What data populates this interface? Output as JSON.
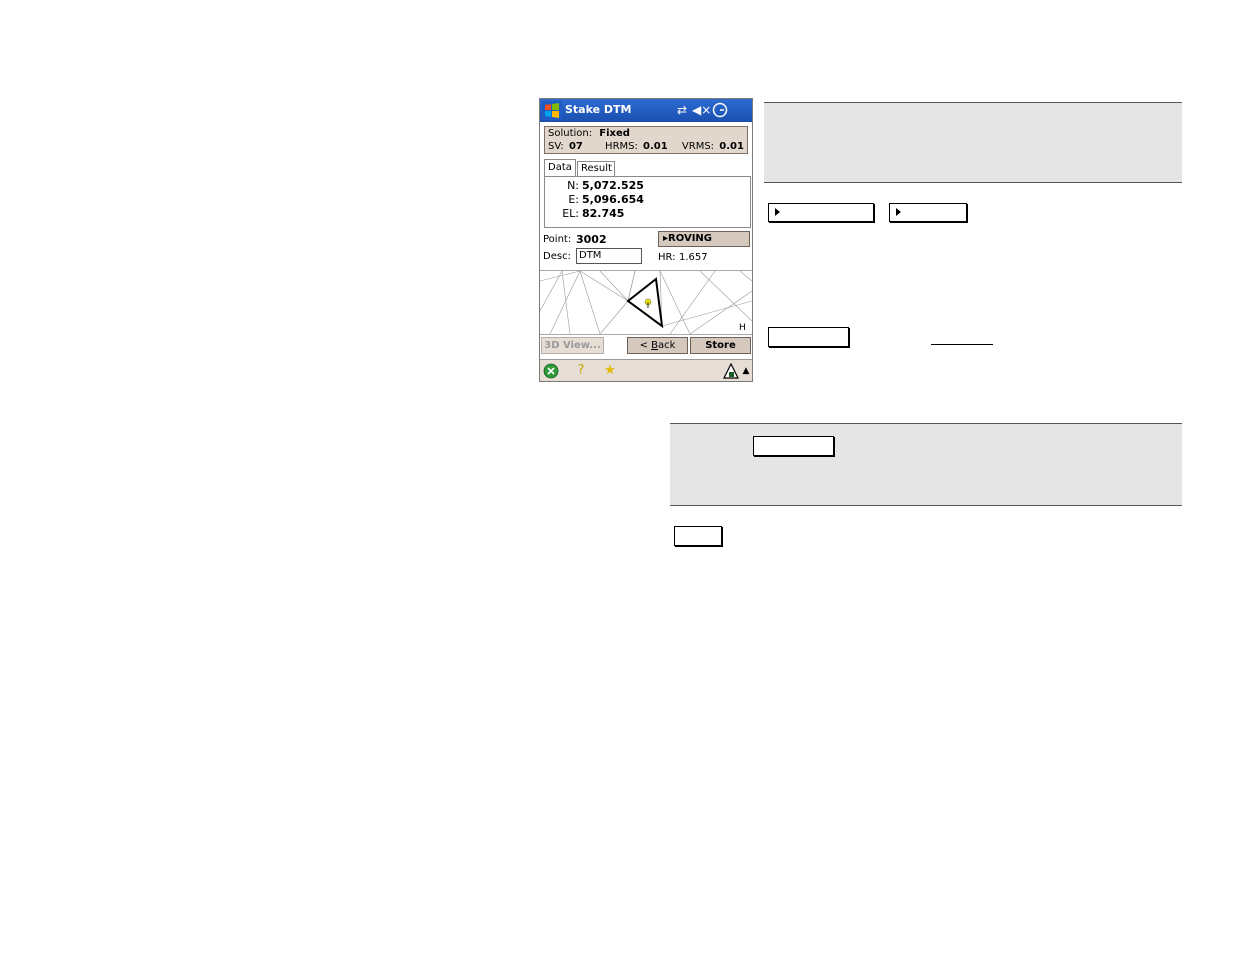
{
  "titlebar": {
    "title": "Stake DTM",
    "icons": [
      "windows-start-icon",
      "connectivity-icon",
      "volume-mute-icon",
      "clock-icon"
    ]
  },
  "status": {
    "solution_label": "Solution:",
    "solution_value": "Fixed",
    "sv_label": "SV:",
    "sv_value": "07",
    "hrms_label": "HRMS:",
    "hrms_value": "0.01",
    "vrms_label": "VRMS:",
    "vrms_value": "0.01"
  },
  "tabs": [
    {
      "label": "Data",
      "active": true
    },
    {
      "label": "Result",
      "active": false
    }
  ],
  "data": {
    "n_label": "N:",
    "n_value": "5,072.525",
    "e_label": "E:",
    "e_value": "5,096.654",
    "el_label": "EL:",
    "el_value": "82.745"
  },
  "point": {
    "point_label": "Point:",
    "point_value": "3002",
    "desc_label": "Desc:",
    "desc_value": "DTM",
    "roving_label": "ROVING",
    "hr_label": "HR:",
    "hr_value": "1.657"
  },
  "map": {
    "corner_label": "H"
  },
  "buttons": {
    "view3d": "3D View...",
    "back_prefix": "< ",
    "back_underlined": "B",
    "back_rest": "ack",
    "store": "Store"
  },
  "bottombar": {
    "icons": [
      "close-icon",
      "help-icon",
      "favorites-icon",
      "survey-status-icon"
    ]
  },
  "colors": {
    "titlebar": "#1a4fb0",
    "panel_tan": "#e2d7cd",
    "button_tan": "#d5c8bd",
    "note_shade": "#e5e5e5"
  }
}
